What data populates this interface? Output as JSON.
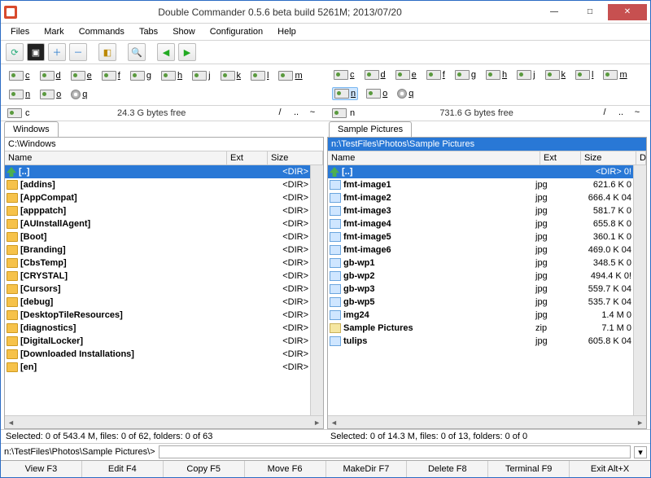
{
  "window": {
    "title": "Double Commander 0.5.6 beta build 5261M; 2013/07/20"
  },
  "menu": [
    "Files",
    "Mark",
    "Commands",
    "Tabs",
    "Show",
    "Configuration",
    "Help"
  ],
  "drives": [
    {
      "letter": "c",
      "type": "hard"
    },
    {
      "letter": "d",
      "type": "hard"
    },
    {
      "letter": "e",
      "type": "hard"
    },
    {
      "letter": "f",
      "type": "hard"
    },
    {
      "letter": "g",
      "type": "hard"
    },
    {
      "letter": "h",
      "type": "hard"
    },
    {
      "letter": "j",
      "type": "hard"
    },
    {
      "letter": "k",
      "type": "hard"
    },
    {
      "letter": "l",
      "type": "hard"
    },
    {
      "letter": "m",
      "type": "hard"
    },
    {
      "letter": "n",
      "type": "hard"
    },
    {
      "letter": "o",
      "type": "hard"
    },
    {
      "letter": "q",
      "type": "cd"
    }
  ],
  "left": {
    "current_drive": "c",
    "free": "24.3 G bytes free",
    "tab": "Windows",
    "path": "C:\\Windows",
    "active": false,
    "cols": {
      "name": "Name",
      "ext": "Ext",
      "size": "Size"
    },
    "rows": [
      {
        "icon": "up",
        "name": "[..]",
        "ext": "",
        "size": "<DIR>",
        "bold": true,
        "sel": true
      },
      {
        "icon": "folder",
        "name": "[addins]",
        "ext": "",
        "size": "<DIR>",
        "bold": true
      },
      {
        "icon": "folder",
        "name": "[AppCompat]",
        "ext": "",
        "size": "<DIR>",
        "bold": true
      },
      {
        "icon": "folder",
        "name": "[apppatch]",
        "ext": "",
        "size": "<DIR>",
        "bold": true
      },
      {
        "icon": "folder",
        "name": "[AUInstallAgent]",
        "ext": "",
        "size": "<DIR>",
        "bold": true
      },
      {
        "icon": "folder",
        "name": "[Boot]",
        "ext": "",
        "size": "<DIR>",
        "bold": true
      },
      {
        "icon": "folder",
        "name": "[Branding]",
        "ext": "",
        "size": "<DIR>",
        "bold": true
      },
      {
        "icon": "folder",
        "name": "[CbsTemp]",
        "ext": "",
        "size": "<DIR>",
        "bold": true
      },
      {
        "icon": "folder",
        "name": "[CRYSTAL]",
        "ext": "",
        "size": "<DIR>",
        "bold": true
      },
      {
        "icon": "folder",
        "name": "[Cursors]",
        "ext": "",
        "size": "<DIR>",
        "bold": true
      },
      {
        "icon": "folder",
        "name": "[debug]",
        "ext": "",
        "size": "<DIR>",
        "bold": true
      },
      {
        "icon": "folder",
        "name": "[DesktopTileResources]",
        "ext": "",
        "size": "<DIR>",
        "bold": true
      },
      {
        "icon": "folder",
        "name": "[diagnostics]",
        "ext": "",
        "size": "<DIR>",
        "bold": true
      },
      {
        "icon": "folder",
        "name": "[DigitalLocker]",
        "ext": "",
        "size": "<DIR>",
        "bold": true
      },
      {
        "icon": "folder",
        "name": "[Downloaded Installations]",
        "ext": "",
        "size": "<DIR>",
        "bold": true
      },
      {
        "icon": "folder",
        "name": "[en]",
        "ext": "",
        "size": "<DIR>",
        "bold": true
      }
    ],
    "status": "Selected: 0 of 543.4 M, files: 0 of 62, folders: 0 of 63"
  },
  "right": {
    "current_drive": "n",
    "free": "731.6 G bytes free",
    "tab": "Sample Pictures",
    "path": "n:\\TestFiles\\Photos\\Sample Pictures",
    "active": true,
    "selected_drive": "n",
    "cols": {
      "name": "Name",
      "ext": "Ext",
      "size": "Size",
      "d": "D"
    },
    "rows": [
      {
        "icon": "up",
        "name": "[..]",
        "ext": "",
        "size": "<DIR> 0!",
        "bold": true,
        "sel": true
      },
      {
        "icon": "img",
        "name": "fmt-image1",
        "ext": "jpg",
        "size": "621.6 K 0",
        "bold": true
      },
      {
        "icon": "img",
        "name": "fmt-image2",
        "ext": "jpg",
        "size": "666.4 K 04",
        "bold": true
      },
      {
        "icon": "img",
        "name": "fmt-image3",
        "ext": "jpg",
        "size": "581.7 K 0",
        "bold": true
      },
      {
        "icon": "img",
        "name": "fmt-image4",
        "ext": "jpg",
        "size": "655.8 K 0",
        "bold": true
      },
      {
        "icon": "img",
        "name": "fmt-image5",
        "ext": "jpg",
        "size": "360.1 K 0",
        "bold": true
      },
      {
        "icon": "img",
        "name": "fmt-image6",
        "ext": "jpg",
        "size": "469.0 K 04",
        "bold": true
      },
      {
        "icon": "img",
        "name": "gb-wp1",
        "ext": "jpg",
        "size": "348.5 K 0",
        "bold": true
      },
      {
        "icon": "img",
        "name": "gb-wp2",
        "ext": "jpg",
        "size": "494.4 K 0!",
        "bold": true
      },
      {
        "icon": "img",
        "name": "gb-wp3",
        "ext": "jpg",
        "size": "559.7 K 04",
        "bold": true
      },
      {
        "icon": "img",
        "name": "gb-wp5",
        "ext": "jpg",
        "size": "535.7 K 04",
        "bold": true
      },
      {
        "icon": "img",
        "name": "img24",
        "ext": "jpg",
        "size": "1.4 M 0",
        "bold": true
      },
      {
        "icon": "zip",
        "name": "Sample Pictures",
        "ext": "zip",
        "size": "7.1 M 0",
        "bold": true
      },
      {
        "icon": "img",
        "name": "tulips",
        "ext": "jpg",
        "size": "605.8 K 04",
        "bold": true
      }
    ],
    "status": "Selected: 0 of 14.3 M, files: 0 of 13, folders: 0 of 0"
  },
  "cmdline": {
    "prompt": "n:\\TestFiles\\Photos\\Sample Pictures\\>",
    "value": ""
  },
  "funcbar": [
    "View F3",
    "Edit F4",
    "Copy F5",
    "Move F6",
    "MakeDir F7",
    "Delete F8",
    "Terminal F9",
    "Exit Alt+X"
  ],
  "nav": {
    "root": "/",
    "up": "..",
    "home": "~"
  }
}
